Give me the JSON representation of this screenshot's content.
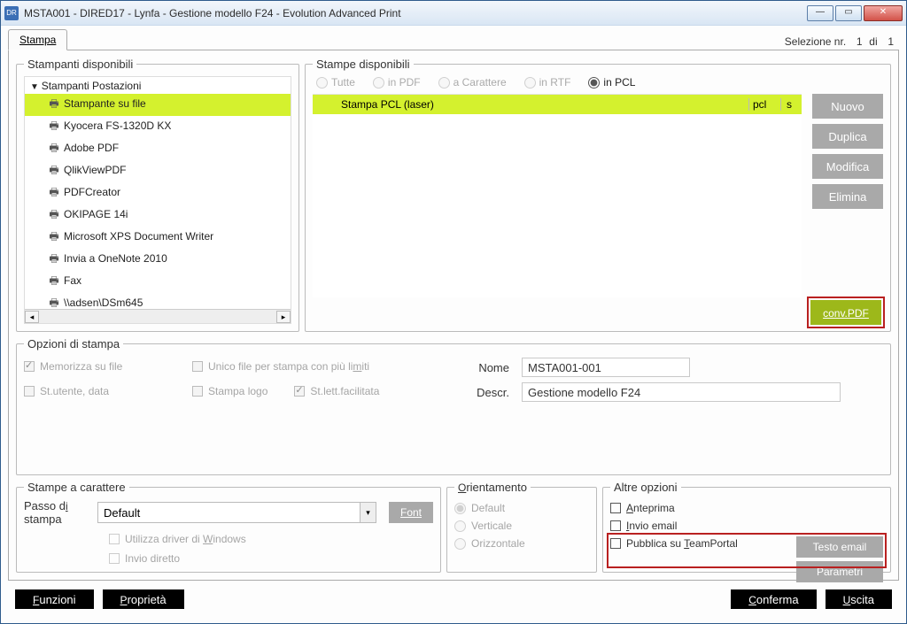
{
  "window": {
    "title": "MSTA001 - DIRED17 - Lynfa - Gestione modello F24 - Evolution Advanced Print"
  },
  "tab": {
    "stampa": "Stampa"
  },
  "selection": {
    "prefix": "Selezione nr.",
    "current": "1",
    "sep": "di",
    "total": "1"
  },
  "printers": {
    "legend": "Stampanti disponibili",
    "root": "Stampanti Postazioni",
    "items": [
      "Stampante su file",
      "Kyocera FS-1320D KX",
      "Adobe PDF",
      "QlikViewPDF",
      "PDFCreator",
      "OKIPAGE 14i",
      "Microsoft XPS Document Writer",
      "Invia a OneNote 2010",
      "Fax",
      "\\\\adsen\\DSm645"
    ]
  },
  "stampe": {
    "legend": "Stampe disponibili",
    "filters": {
      "tutte": "Tutte",
      "pdf": "in PDF",
      "carattere": "a Carattere",
      "rtf": "in RTF",
      "pcl": "in PCL"
    },
    "row": {
      "name": "Stampa PCL (laser)",
      "fmt": "pcl",
      "flag": "s"
    },
    "btns": {
      "nuovo": "Nuovo",
      "duplica": "Duplica",
      "modifica": "Modifica",
      "elimina": "Elimina",
      "conv": "conv.PDF"
    }
  },
  "opzioni": {
    "legend": "Opzioni di stampa",
    "mem": "Memorizza su file",
    "unico": "Unico file per stampa con più limiti",
    "stutente": "St.utente, data",
    "logo": "Stampa logo",
    "facil": "St.lett.facilitata",
    "nome_l": "Nome",
    "nome_v": "MSTA001-001",
    "descr_l": "Descr.",
    "descr_v": "Gestione modello F24"
  },
  "char": {
    "legend": "Stampe a carattere",
    "passo_l": "Passo di stampa",
    "passo_v": "Default",
    "font": "Font",
    "driver": "Utilizza driver di Windows",
    "diretto": "Invio diretto"
  },
  "ori": {
    "legend": "Orientamento",
    "def": "Default",
    "vert": "Verticale",
    "oriz": "Orizzontale"
  },
  "altre": {
    "legend": "Altre opzioni",
    "ante": "Anteprima",
    "email": "Invio email",
    "portal": "Pubblica su TeamPortal",
    "testo": "Testo email",
    "param": "Parametri"
  },
  "footer": {
    "funzioni": "Funzioni",
    "proprieta": "Proprietà",
    "conferma": "Conferma",
    "uscita": "Uscita"
  }
}
